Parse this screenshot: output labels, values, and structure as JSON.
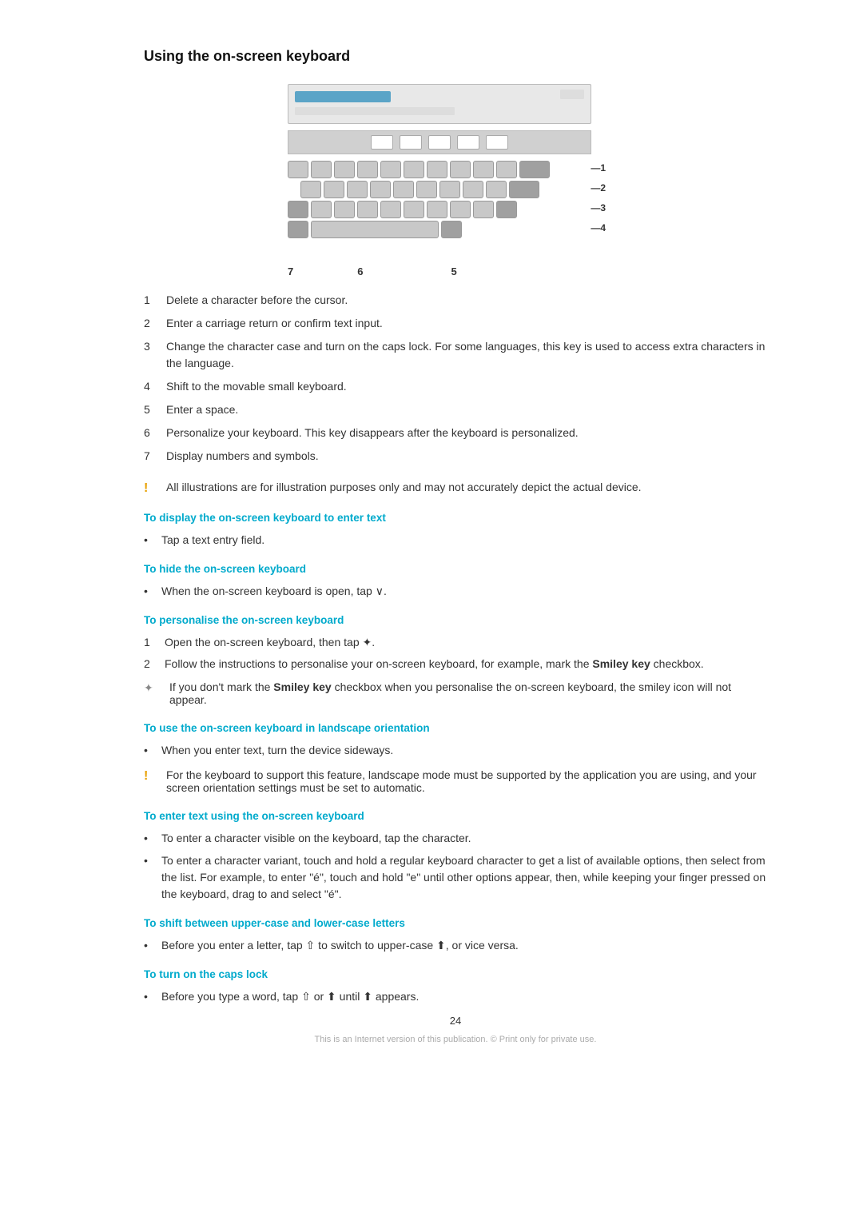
{
  "page": {
    "title": "Using the on-screen keyboard",
    "page_number": "24",
    "footer_note": "This is an Internet version of this publication. © Print only for private use."
  },
  "diagram": {
    "bottom_labels": [
      "7",
      "6",
      "5"
    ],
    "side_labels": [
      "1",
      "2",
      "3",
      "4"
    ]
  },
  "numbered_items": [
    {
      "num": "1",
      "text": "Delete a character before the cursor."
    },
    {
      "num": "2",
      "text": "Enter a carriage return or confirm text input."
    },
    {
      "num": "3",
      "text": "Change the character case and turn on the caps lock. For some languages, this key is used to access extra characters in the language."
    },
    {
      "num": "4",
      "text": "Shift to the movable small keyboard."
    },
    {
      "num": "5",
      "text": "Enter a space."
    },
    {
      "num": "6",
      "text": "Personalize your keyboard. This key disappears after the keyboard is personalized."
    },
    {
      "num": "7",
      "text": "Display numbers and symbols."
    }
  ],
  "notice1": {
    "icon": "!",
    "text": "All illustrations are for illustration purposes only and may not accurately depict the actual device."
  },
  "sections": [
    {
      "heading": "To display the on-screen keyboard to enter text",
      "type": "bullet",
      "items": [
        "Tap a text entry field."
      ]
    },
    {
      "heading": "To hide the on-screen keyboard",
      "type": "bullet",
      "items": [
        "When the on-screen keyboard is open, tap ∨."
      ]
    },
    {
      "heading": "To personalise the on-screen keyboard",
      "type": "ordered",
      "items": [
        "Open the on-screen keyboard, then tap ✦.",
        "Follow the instructions to personalise your on-screen keyboard, for example, mark the Smiley key checkbox."
      ],
      "tip": {
        "icon": "✦",
        "text": "If you don't mark the Smiley key checkbox when you personalise the on-screen keyboard, the smiley icon will not appear."
      }
    },
    {
      "heading": "To use the on-screen keyboard in landscape orientation",
      "type": "bullet",
      "items": [
        "When you enter text, turn the device sideways."
      ],
      "notice": "For the keyboard to support this feature, landscape mode must be supported by the application you are using, and your screen orientation settings must be set to automatic."
    },
    {
      "heading": "To enter text using the on-screen keyboard",
      "type": "bullet",
      "items": [
        "To enter a character visible on the keyboard, tap the character.",
        "To enter a character variant, touch and hold a regular keyboard character to get a list of available options, then select from the list. For example, to enter \"é\", touch and hold \"e\" until other options appear, then, while keeping your finger pressed on the keyboard, drag to and select \"é\"."
      ]
    },
    {
      "heading": "To shift between upper-case and lower-case letters",
      "type": "bullet",
      "items": [
        "Before you enter a letter, tap ⇧ to switch to upper-case ⬆, or vice versa."
      ]
    },
    {
      "heading": "To turn on the caps lock",
      "type": "bullet",
      "items": [
        "Before you type a word, tap ⇧ or ⬆ until ⬆ appears."
      ]
    }
  ]
}
